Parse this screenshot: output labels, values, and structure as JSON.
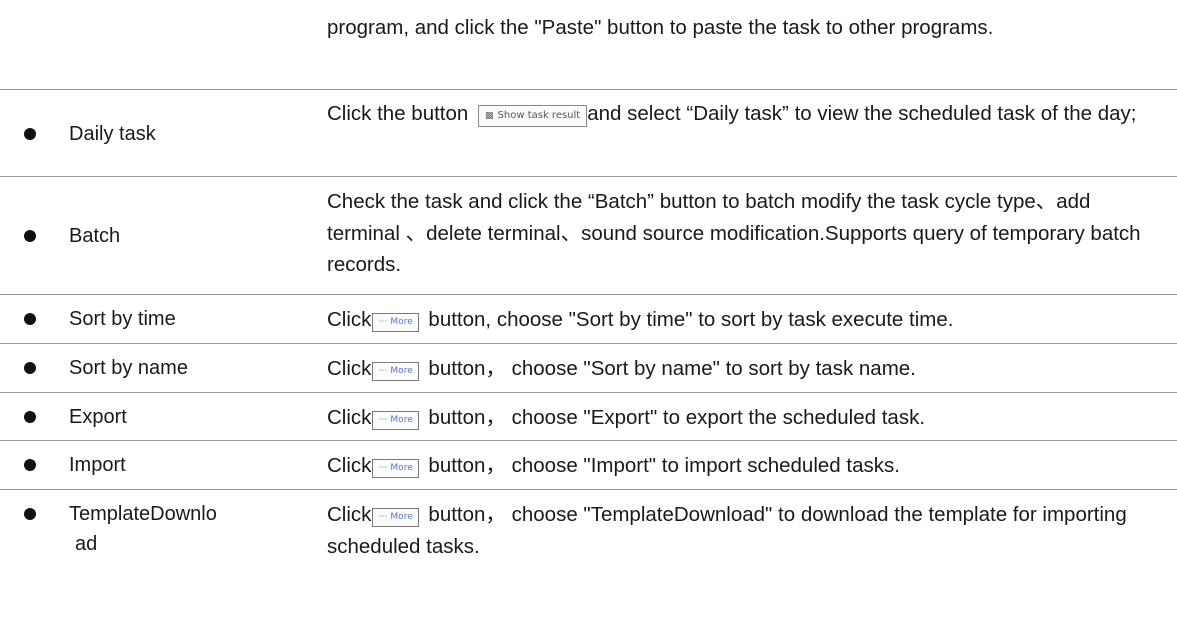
{
  "rows": [
    {
      "name": "",
      "desc": "program, and click the \"Paste\" button to paste the task to other programs."
    },
    {
      "name": "Daily task",
      "desc_prefix": "Click the button",
      "button": "Show task result",
      "desc_suffix": "and select “Daily task” to view the scheduled task of the day;"
    },
    {
      "name": "Batch",
      "desc": "Check the task and click the “Batch” button to batch modify the task cycle type、add terminal 、delete terminal、sound source modification.Supports query of temporary batch records."
    },
    {
      "name": "Sort by time",
      "prefix": "Click",
      "suffix": " button, choose \"Sort by time\" to sort by task execute time."
    },
    {
      "name": "Sort by name",
      "prefix": "Click",
      "suffix": " button， choose \"Sort by name\" to sort by task name."
    },
    {
      "name": "Export",
      "prefix": "Click",
      "suffix": " button， choose \"Export\" to export the scheduled task."
    },
    {
      "name": "Import",
      "prefix": "Click",
      "suffix": " button， choose \"Import\" to import scheduled tasks."
    },
    {
      "name_line1": "TemplateDownlo",
      "name_line2": "ad",
      "prefix": "Click",
      "suffix": " button， choose \"TemplateDownload\" to download the template for importing scheduled tasks."
    }
  ],
  "more_button": "More",
  "more_icon": "ellipsis-icon",
  "show_task_icon": "document-icon"
}
